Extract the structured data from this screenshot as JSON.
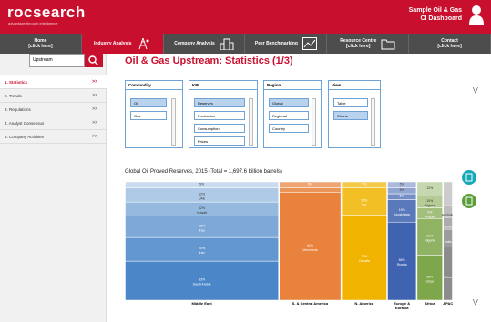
{
  "header": {
    "logo": "rocsearch",
    "tagline": "advantage through intelligence",
    "user_line1": "Sample Oil & Gas",
    "user_line2": "CI Dashboard"
  },
  "nav": [
    {
      "label": "Home\n[click here]"
    },
    {
      "label": "Industry Analysis"
    },
    {
      "label": "Company Analysis"
    },
    {
      "label": "Peer Benchmarking"
    },
    {
      "label": "Resource Centre\n[click here]"
    },
    {
      "label": "Contact\n[click here]"
    }
  ],
  "sidebar": {
    "search_value": "Upstream",
    "items": [
      {
        "label": "1. Statistics",
        "chev": ">>"
      },
      {
        "label": "2. Trends",
        "chev": ">>"
      },
      {
        "label": "3. Regulations",
        "chev": ">>"
      },
      {
        "label": "4. Analyst Consensus",
        "chev": ">>"
      },
      {
        "label": "5. Company Activities",
        "chev": ">>"
      }
    ]
  },
  "page_title": "Oil & Gas Upstream: Statistics (1/3)",
  "filters": {
    "commodity": {
      "title": "Commodity",
      "options": [
        "Oil",
        "Gas"
      ]
    },
    "kpi": {
      "title": "KPI",
      "options": [
        "Reserves",
        "Production",
        "Consumption",
        "Prices"
      ]
    },
    "region": {
      "title": "Region",
      "options": [
        "Global",
        "Regional",
        "Country"
      ]
    },
    "view": {
      "title": "View",
      "options": [
        "Table",
        "Charts"
      ]
    }
  },
  "collapse_icon": "double-chevron",
  "chart_title": "Global Oil Proved Reserves, 2015 (Total = 1,697.6 billion barrels)",
  "chart_data": {
    "type": "marimekko",
    "title": "Global Oil Proved Reserves, 2015 (Total = 1,697.6 billion barrels)",
    "categories": [
      {
        "name": "Middle East",
        "share": 47
      },
      {
        "name": "S. & Central America",
        "share": 19
      },
      {
        "name": "N. America",
        "share": 14
      },
      {
        "name": "Europe & Eurasia",
        "share": 9
      },
      {
        "name": "Africa",
        "share": 8
      },
      {
        "name": "APAC",
        "share": 3
      }
    ],
    "segments": {
      "Middle East": [
        {
          "label": "Saudi Arabia",
          "pct": "33%",
          "value": 33
        },
        {
          "label": "Iran",
          "pct": "20%",
          "value": 20
        },
        {
          "label": "Iraq",
          "pct": "18%",
          "value": 18
        },
        {
          "label": "Kuwait",
          "pct": "12%",
          "value": 12
        },
        {
          "label": "UAE",
          "pct": "12%",
          "value": 12
        },
        {
          "label": "",
          "pct": "5%",
          "value": 5
        }
      ],
      "S. & Central America": [
        {
          "label": "Venezuela",
          "pct": "91%",
          "value": 91
        },
        {
          "label": "Brazil",
          "pct": "4%",
          "value": 4
        },
        {
          "label": "",
          "pct": "5%",
          "value": 5
        }
      ],
      "N. America": [
        {
          "label": "Canada",
          "pct": "72%",
          "value": 72
        },
        {
          "label": "US",
          "pct": "23%",
          "value": 23
        },
        {
          "label": "",
          "pct": "5%",
          "value": 5
        }
      ],
      "Europe & Eurasia": [
        {
          "label": "Russia",
          "pct": "66%",
          "value": 66
        },
        {
          "label": "Kazakhstan",
          "pct": "19%",
          "value": 19
        },
        {
          "label": "",
          "pct": "5%",
          "value": 5
        },
        {
          "label": "",
          "pct": "5%",
          "value": 5
        },
        {
          "label": "",
          "pct": "5%",
          "value": 5
        }
      ],
      "Africa": [
        {
          "label": "Libya",
          "pct": "38%",
          "value": 38
        },
        {
          "label": "Nigeria",
          "pct": "31%",
          "value": 31
        },
        {
          "label": "Angola",
          "pct": "9%",
          "value": 9
        },
        {
          "label": "Algeria",
          "pct": "10%",
          "value": 10
        },
        {
          "label": "",
          "pct": "12%",
          "value": 12
        }
      ],
      "APAC": [
        {
          "label": "China",
          "pct": "",
          "value": 45
        },
        {
          "label": "India",
          "pct": "",
          "value": 15
        },
        {
          "label": "Vietnam",
          "pct": "",
          "value": 10
        },
        {
          "label": "Australia",
          "pct": "",
          "value": 10
        },
        {
          "label": "",
          "pct": "",
          "value": 20
        }
      ]
    },
    "colors": {
      "Middle East": "#4a86c8",
      "S. & Central America": "#e8823c",
      "N. America": "#f0b400",
      "Europe & Eurasia": "#3f63b0",
      "Africa": "#7ea64a",
      "APAC": "#8c8c8c"
    }
  }
}
